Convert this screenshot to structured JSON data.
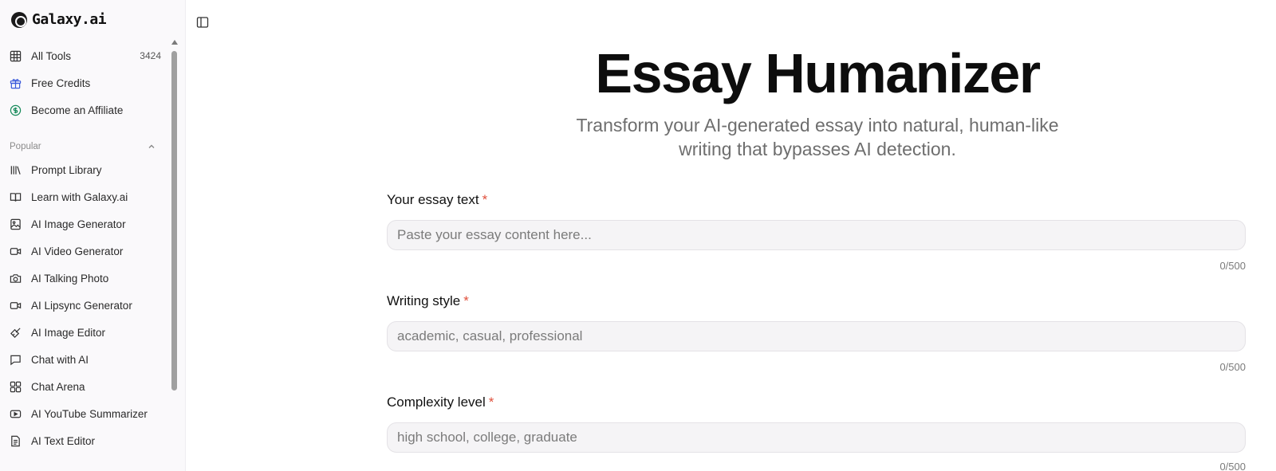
{
  "brand": {
    "name": "Galaxy.ai"
  },
  "sidebar": {
    "top_items": [
      {
        "label": "All Tools",
        "count": "3424",
        "icon": "grid-icon"
      },
      {
        "label": "Free Credits",
        "icon": "gift-icon",
        "color": "#3b5bdb"
      },
      {
        "label": "Become an Affiliate",
        "icon": "dollar-circle-icon",
        "color": "#168a5a"
      }
    ],
    "section": {
      "label": "Popular"
    },
    "items": [
      {
        "label": "Prompt Library",
        "icon": "library-icon"
      },
      {
        "label": "Learn with Galaxy.ai",
        "icon": "book-open-icon"
      },
      {
        "label": "AI Image Generator",
        "icon": "image-icon"
      },
      {
        "label": "AI Video Generator",
        "icon": "video-icon"
      },
      {
        "label": "AI Talking Photo",
        "icon": "camera-icon"
      },
      {
        "label": "AI Lipsync Generator",
        "icon": "video-icon"
      },
      {
        "label": "AI Image Editor",
        "icon": "brush-icon"
      },
      {
        "label": "Chat with AI",
        "icon": "chat-icon"
      },
      {
        "label": "Chat Arena",
        "icon": "layout-grid-icon"
      },
      {
        "label": "AI YouTube Summarizer",
        "icon": "youtube-icon"
      },
      {
        "label": "AI Text Editor",
        "icon": "file-text-icon"
      }
    ]
  },
  "main": {
    "title": "Essay Humanizer",
    "subtitle_line1": "Transform your AI-generated essay into natural, human-like",
    "subtitle_line2": "writing that bypasses AI detection.",
    "fields": [
      {
        "label": "Your essay text",
        "required": "*",
        "placeholder": "Paste your essay content here...",
        "counter": "0/500"
      },
      {
        "label": "Writing style",
        "required": "*",
        "placeholder": "academic, casual, professional",
        "counter": "0/500"
      },
      {
        "label": "Complexity level",
        "required": "*",
        "placeholder": "high school, college, graduate",
        "counter": "0/500"
      }
    ]
  },
  "colors": {
    "accent_required": "#e0503c",
    "sidebar_bg": "#faf9fb"
  }
}
